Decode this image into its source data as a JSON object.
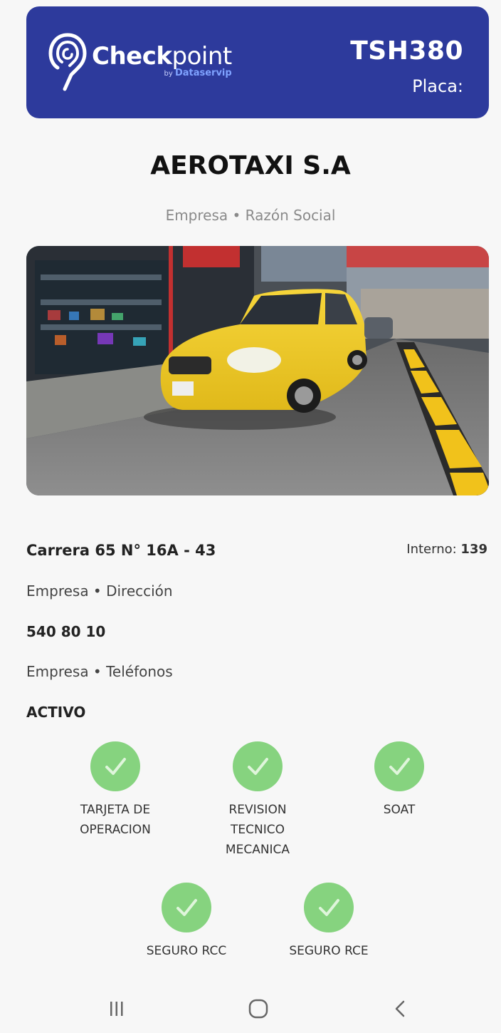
{
  "header": {
    "logo": {
      "word_bold": "Check",
      "word_light": "point",
      "by": "by",
      "brand": "Dataservip"
    },
    "plate_number": "TSH380",
    "plate_label": "Placa:"
  },
  "company": {
    "name": "AEROTAXI S.A",
    "subtitle": "Empresa • Razón Social"
  },
  "photo": {
    "alt": "yellow taxi photo"
  },
  "details": {
    "address": "Carrera 65 N° 16A - 43",
    "address_label": "Empresa • Dirección",
    "interno_label": "Interno:",
    "interno_value": "139",
    "phone": "540 80 10",
    "phone_label": "Empresa • Teléfonos",
    "status": "ACTIVO"
  },
  "documents": [
    {
      "line1": "TARJETA DE",
      "line2": "OPERACION",
      "line3": ""
    },
    {
      "line1": "REVISION",
      "line2": "TECNICO",
      "line3": "MECANICA"
    },
    {
      "line1": "SOAT",
      "line2": "",
      "line3": ""
    },
    {
      "line1": "SEGURO RCC",
      "line2": "",
      "line3": ""
    },
    {
      "line1": "SEGURO RCE",
      "line2": "",
      "line3": ""
    }
  ],
  "colors": {
    "header_bg": "#2d3a9c",
    "check_green": "#86d37f"
  },
  "navbar": {
    "icons": [
      "recent-apps-icon",
      "home-icon",
      "back-icon"
    ]
  }
}
